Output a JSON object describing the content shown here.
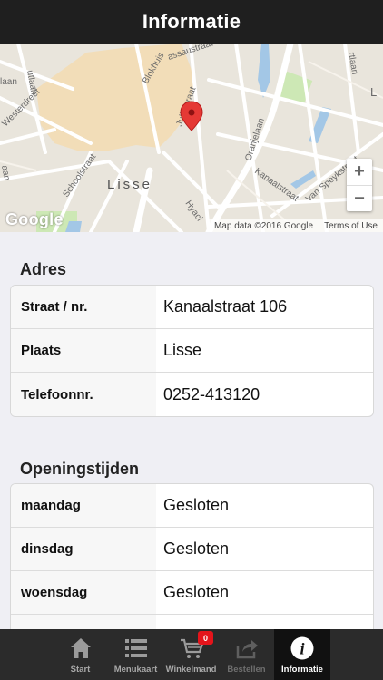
{
  "header": {
    "title": "Informatie"
  },
  "map": {
    "labels": {
      "utlaan_left": "utlaan",
      "laan_left": "laan",
      "westerdreef": "Westerdreef",
      "aan_left": "aan",
      "schoolstraat": "Schoolstraat",
      "lisse": "Lisse",
      "blokhuis": "Blokhuis",
      "passaustraat": "assaustraat",
      "jstraat": "Juliestraat",
      "oranjelaan": "Oranjelaan",
      "kanaalstraat": "Kanaalstraat",
      "vanspeyk": "Van Speykstraat",
      "hyacinth": "Hyaci",
      "rtlaan": "rtlaan",
      "l_right": "L"
    },
    "zoom_in": "+",
    "zoom_out": "−",
    "attribution": "Map data ©2016 Google",
    "terms": "Terms of Use",
    "logo": "Google",
    "accent": "#e53935"
  },
  "address": {
    "title": "Adres",
    "rows": [
      {
        "key": "Straat / nr.",
        "value": "Kanaalstraat 106"
      },
      {
        "key": "Plaats",
        "value": "Lisse"
      },
      {
        "key": "Telefoonnr.",
        "value": "0252-413120"
      }
    ]
  },
  "hours": {
    "title": "Openingstijden",
    "rows": [
      {
        "key": "maandag",
        "value": "Gesloten"
      },
      {
        "key": "dinsdag",
        "value": "Gesloten"
      },
      {
        "key": "woensdag",
        "value": "Gesloten"
      }
    ]
  },
  "tabbar": {
    "items": [
      {
        "label": "Start",
        "icon": "home-icon"
      },
      {
        "label": "Menukaart",
        "icon": "list-icon"
      },
      {
        "label": "Winkelmand",
        "icon": "cart-icon",
        "badge": "0"
      },
      {
        "label": "Bestellen",
        "icon": "share-icon"
      },
      {
        "label": "Informatie",
        "icon": "info-icon"
      }
    ],
    "active": "Informatie",
    "badge_color": "#e5141b"
  }
}
